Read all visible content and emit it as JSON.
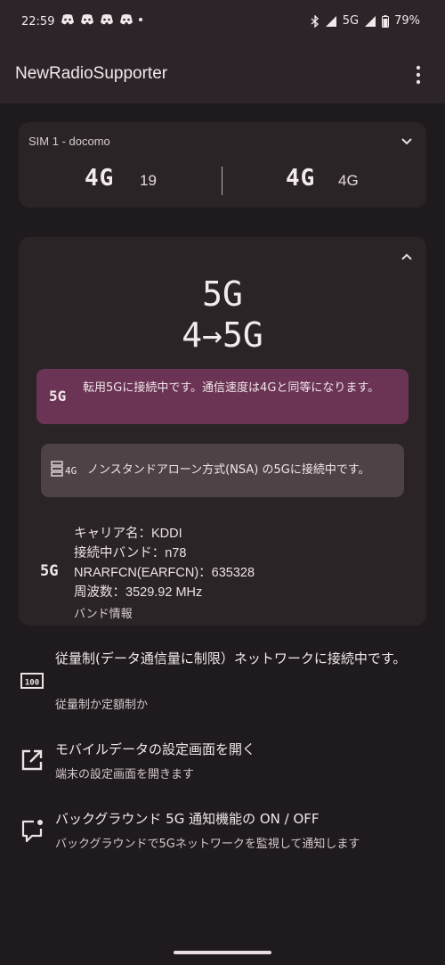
{
  "status_bar": {
    "time": "22:59",
    "network": "5G",
    "battery": "79%",
    "notification_icons": [
      "discord-icon",
      "discord-icon",
      "discord-icon",
      "discord-icon"
    ]
  },
  "app_bar": {
    "title": "NewRadioSupporter"
  },
  "sim_card": {
    "title": "SIM 1 - docomo",
    "left_network": "4G",
    "left_value": "19",
    "right_network": "4G",
    "right_value": "4G"
  },
  "main_card": {
    "network_type": "5G",
    "transition": "4→5G",
    "dss_badge": "5G",
    "dss_message": "転用5Gに接続中です。通信速度は4Gと同等になります。",
    "nsa_badge": "4G",
    "nsa_message": "ノンスタンドアローン方式(NSA) の5Gに接続中です。",
    "info_badge": "5G",
    "carrier": "キャリア名：KDDI",
    "band": "接続中バンド：n78",
    "arfcn": "NRARFCN(EARFCN)：635328",
    "frequency": "周波数：3529.92 MHz",
    "band_info_label": "バンド情報"
  },
  "settings": [
    {
      "title": "従量制(データ通信量に制限）ネットワークに接続中です。",
      "subtitle": "従量制か定額制か",
      "icon": "meter-icon"
    },
    {
      "title": "モバイルデータの設定画面を開く",
      "subtitle": "端末の設定画面を開きます",
      "icon": "open-external-icon"
    },
    {
      "title": "バックグラウンド 5G 通知機能の ON / OFF",
      "subtitle": "バックグラウンドで5Gネットワークを監視して通知します",
      "icon": "notification-message-icon"
    }
  ]
}
